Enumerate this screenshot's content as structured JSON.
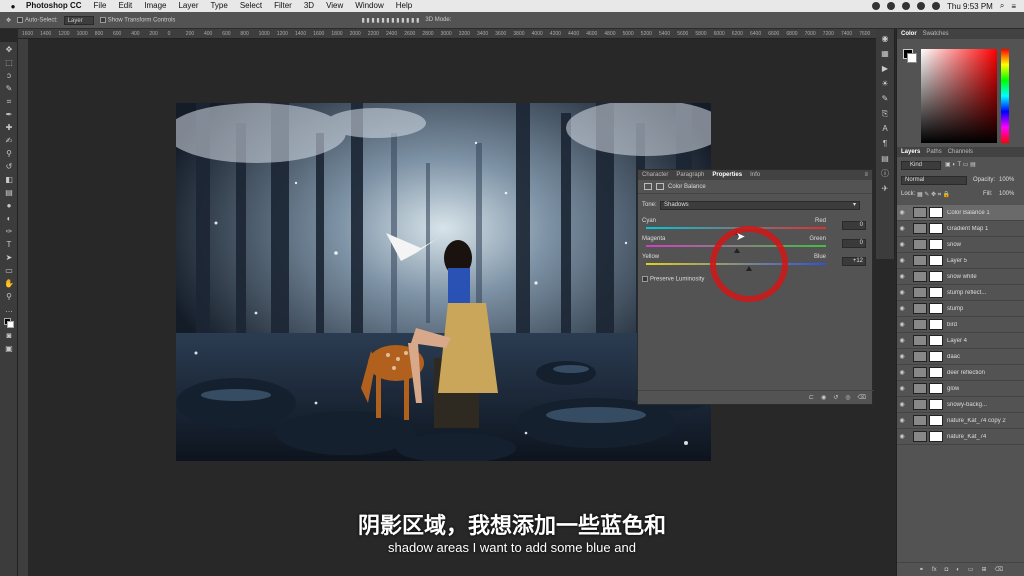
{
  "menubar": {
    "app": "Photoshop CC",
    "items": [
      "File",
      "Edit",
      "Image",
      "Layer",
      "Type",
      "Select",
      "Filter",
      "3D",
      "View",
      "Window",
      "Help"
    ],
    "clock": "Thu 9:53 PM"
  },
  "options": {
    "auto_select_label": "Auto-Select:",
    "auto_select_value": "Layer",
    "transform_label": "Show Transform Controls",
    "mode_3d": "3D Mode:"
  },
  "ruler": {
    "ticks": [
      "1600",
      "1400",
      "1200",
      "1000",
      "800",
      "600",
      "400",
      "200",
      "0",
      "200",
      "400",
      "600",
      "800",
      "1000",
      "1200",
      "1400",
      "1600",
      "1800",
      "2000",
      "2200",
      "2400",
      "2600",
      "2800",
      "3000",
      "3200",
      "3400",
      "3600",
      "3800",
      "4000",
      "4200",
      "4400",
      "4600",
      "4800",
      "5000",
      "5200",
      "5400",
      "5600",
      "5800",
      "6000",
      "6200",
      "6400",
      "6600",
      "6800",
      "7000",
      "7200",
      "7400",
      "7600"
    ]
  },
  "properties": {
    "tabs": [
      "Character",
      "Paragraph",
      "Properties",
      "Info"
    ],
    "active_tab": "Properties",
    "title": "Color Balance",
    "tone_label": "Tone:",
    "tone_value": "Shadows",
    "sliders": [
      {
        "left": "Cyan",
        "right": "Red",
        "value": "0",
        "pos": 0.5,
        "color_left": "#00c8d8",
        "color_right": "#e03030"
      },
      {
        "left": "Magenta",
        "right": "Green",
        "value": "0",
        "pos": 0.5,
        "color_left": "#d040c0",
        "color_right": "#40c040"
      },
      {
        "left": "Yellow",
        "right": "Blue",
        "value": "+12",
        "pos": 0.56,
        "color_left": "#e0d020",
        "color_right": "#3050e0"
      }
    ],
    "preserve_luminosity": "Preserve Luminosity"
  },
  "color_panel": {
    "tabs": [
      "Color",
      "Swatches"
    ],
    "active_tab": "Color"
  },
  "layers_panel": {
    "tabs": [
      "Layers",
      "Paths",
      "Channels"
    ],
    "active_tab": "Layers",
    "kind_label": "Kind",
    "blend_mode": "Normal",
    "opacity_label": "Opacity:",
    "opacity": "100%",
    "lock_label": "Lock:",
    "fill_label": "Fill:",
    "fill": "100%",
    "layers": [
      {
        "name": "Color Balance 1",
        "selected": true
      },
      {
        "name": "Gradient Map 1",
        "selected": false
      },
      {
        "name": "snow",
        "selected": false
      },
      {
        "name": "Layer 5",
        "selected": false
      },
      {
        "name": "snow white",
        "selected": false
      },
      {
        "name": "stump reflect...",
        "selected": false
      },
      {
        "name": "stump",
        "selected": false
      },
      {
        "name": "bird",
        "selected": false
      },
      {
        "name": "Layer 4",
        "selected": false
      },
      {
        "name": "daac",
        "selected": false
      },
      {
        "name": "deer reflection",
        "selected": false
      },
      {
        "name": "glow",
        "selected": false
      },
      {
        "name": "snowy-backg...",
        "selected": false
      },
      {
        "name": "nature_Kat_74 copy 2",
        "selected": false
      },
      {
        "name": "nature_Kat_74",
        "selected": false
      }
    ]
  },
  "subtitles": {
    "chinese": "阴影区域，我想添加一些蓝色和",
    "english": "shadow areas I want to add some blue and"
  },
  "colors": {
    "highlight_circle": "#cc1a1a",
    "accent": "#6a6a6a"
  }
}
